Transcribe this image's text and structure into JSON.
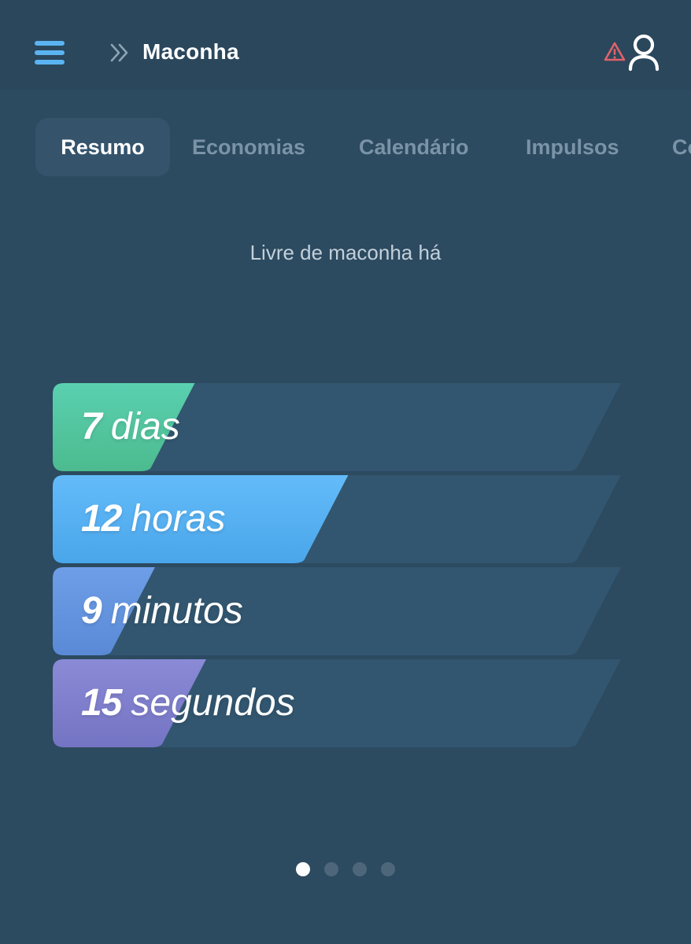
{
  "header": {
    "title": "Maconha",
    "menu_icon": "hamburger-menu-icon",
    "breadcrumb_icon": "double-chevron-right-icon",
    "warning_icon": "warning-triangle-icon",
    "profile_icon": "user-icon"
  },
  "tabs": [
    {
      "label": "Resumo",
      "active": true
    },
    {
      "label": "Economias",
      "active": false
    },
    {
      "label": "Calendário",
      "active": false
    },
    {
      "label": "Impulsos",
      "active": false
    },
    {
      "label": "Conquistas",
      "active": false
    }
  ],
  "summary": {
    "subtitle": "Livre de maconha há",
    "counters": [
      {
        "value": "7",
        "unit": "dias",
        "progress": 0.25,
        "color_start": "#5ad0b0",
        "color_end": "#4cbb8f"
      },
      {
        "value": "12",
        "unit": "horas",
        "progress": 0.52,
        "color_start": "#63bbf9",
        "color_end": "#4aa6ea"
      },
      {
        "value": "9",
        "unit": "minutos",
        "progress": 0.18,
        "color_start": "#6f9ee8",
        "color_end": "#5a8ad6"
      },
      {
        "value": "15",
        "unit": "segundos",
        "progress": 0.27,
        "color_start": "#8a8ad6",
        "color_end": "#7474c4"
      }
    ],
    "track_color": "#32566f"
  },
  "pager": {
    "pages": 4,
    "active_index": 0
  },
  "colors": {
    "background": "#2c4a60",
    "header": "#2a475c",
    "accent": "#5bb4f2",
    "warning": "#e0626a"
  }
}
